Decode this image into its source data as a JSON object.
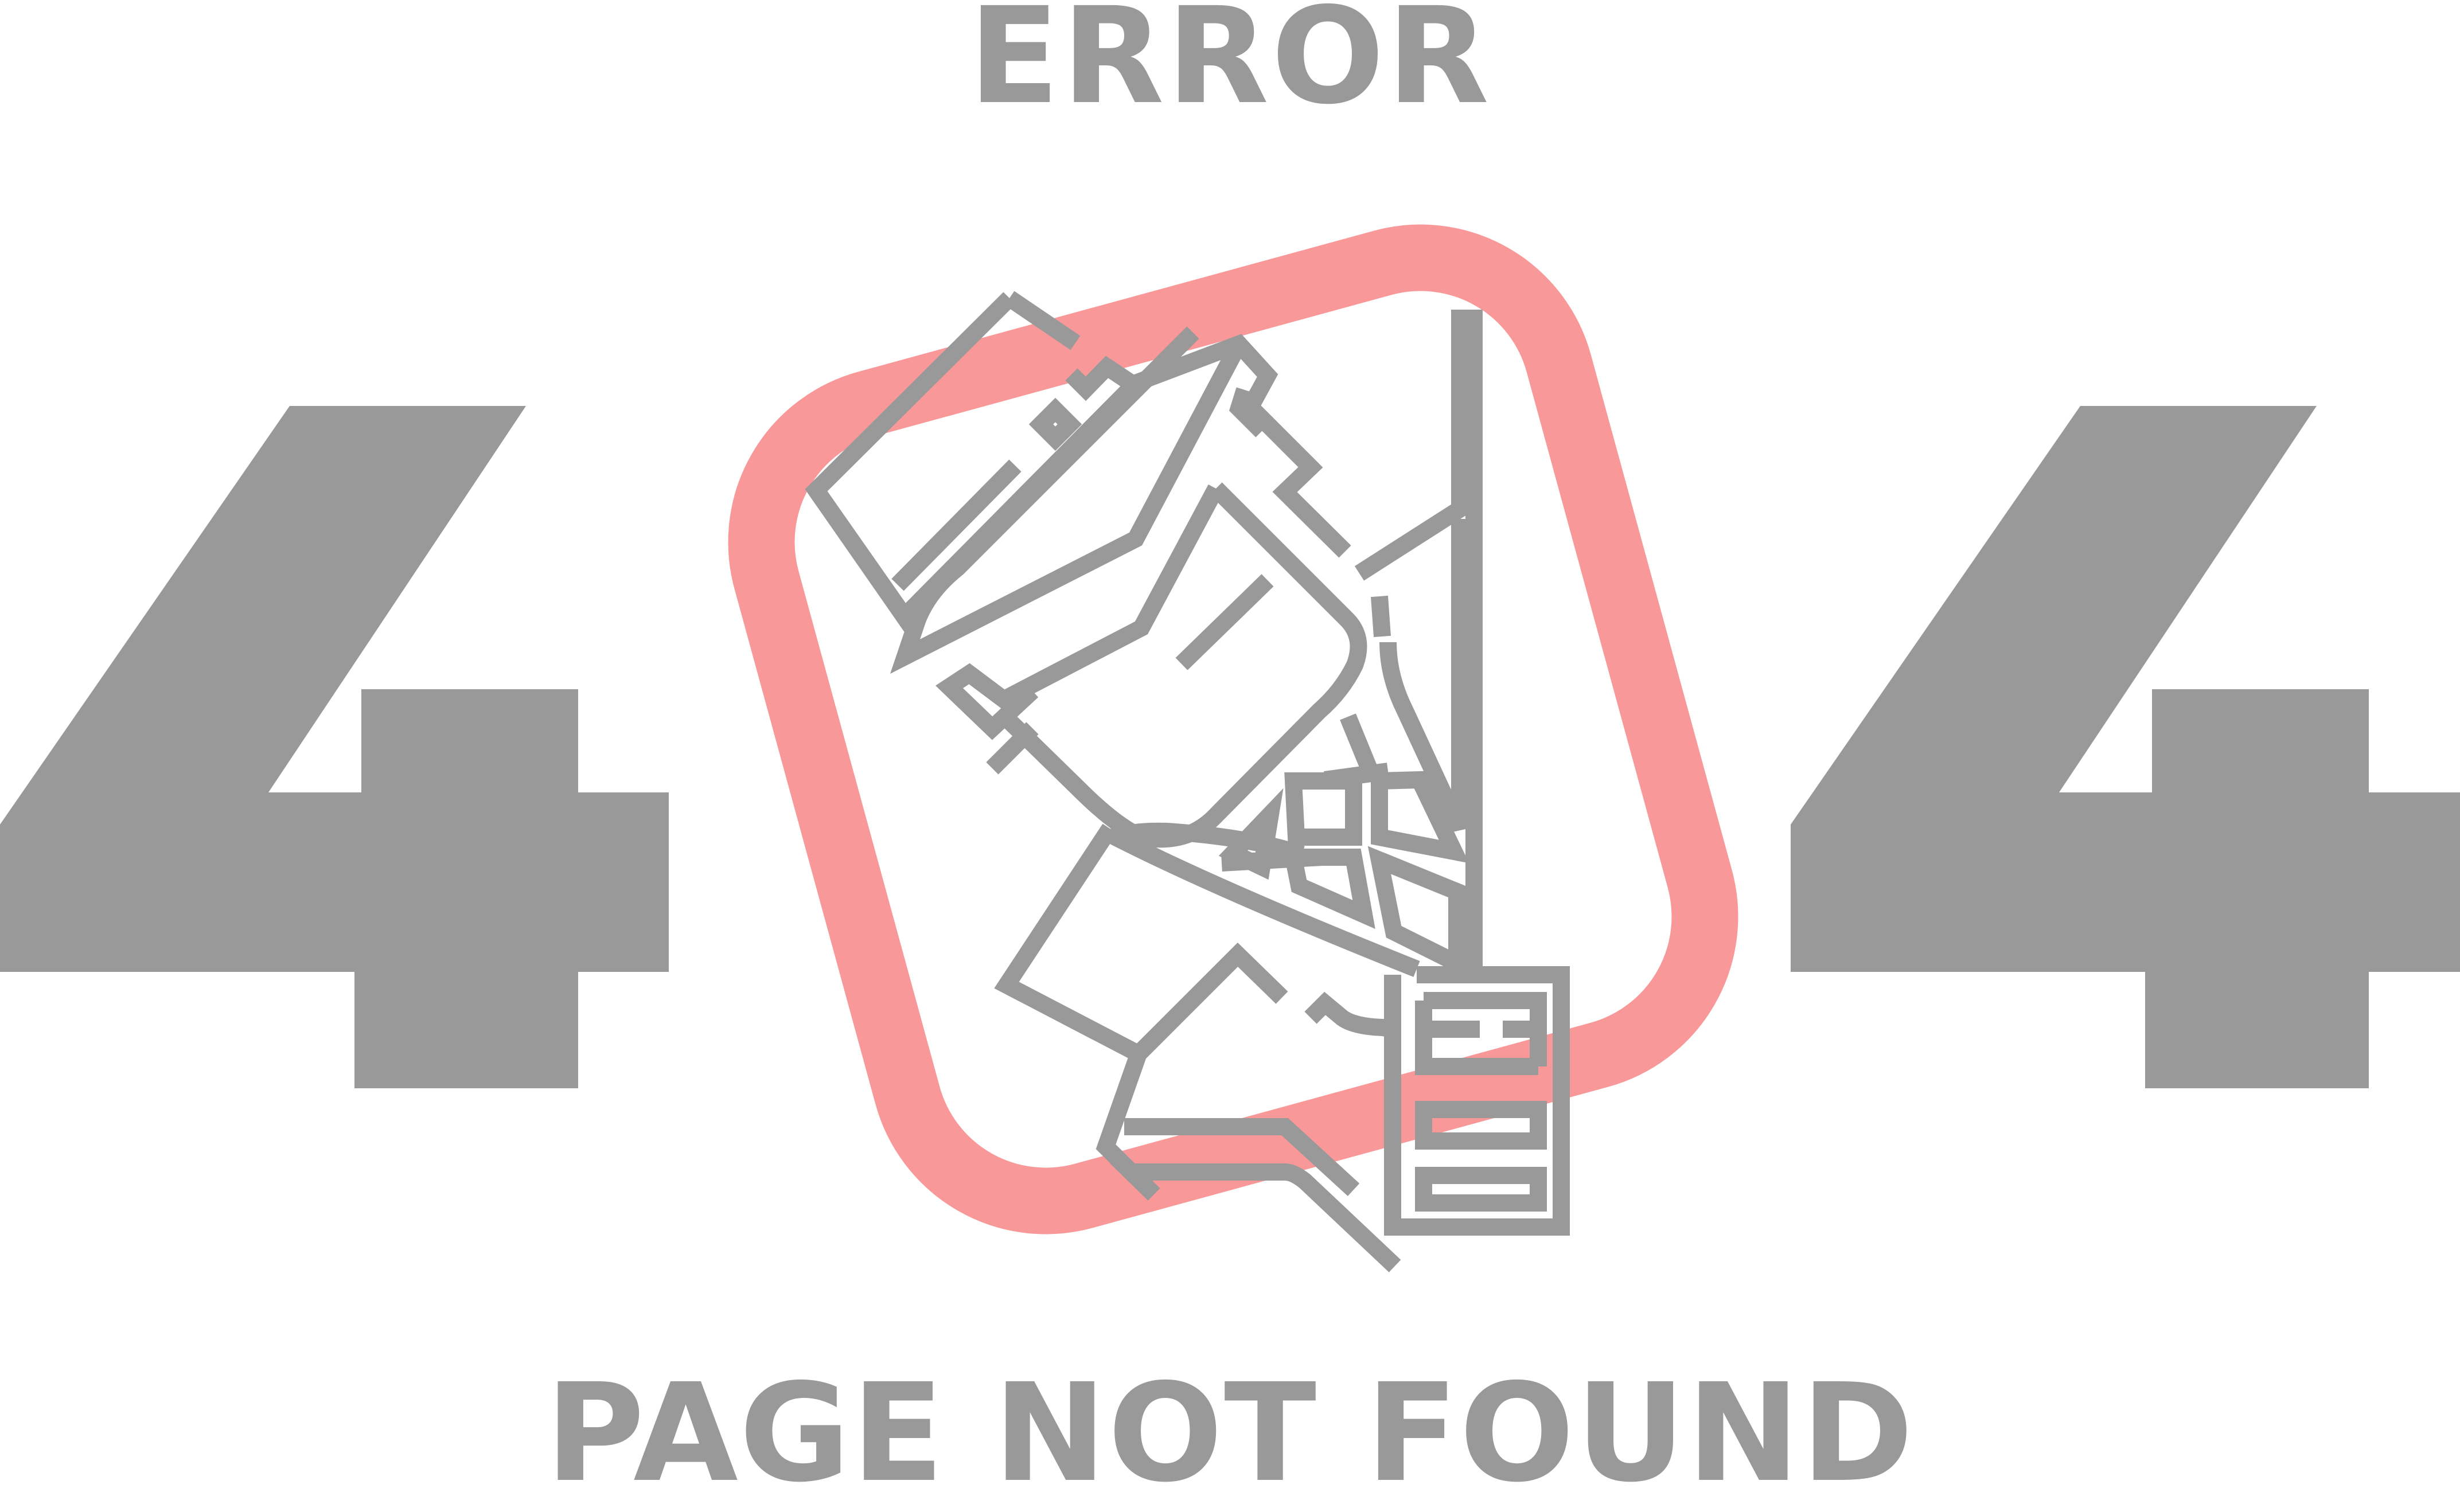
{
  "top_title": "ERROR",
  "bottom_title": "PAGE NOT FOUND",
  "code": {
    "left_digit": "4",
    "right_digit": "4"
  },
  "colors": {
    "gray": "#999999",
    "accent": "#f99898",
    "background": "#ffffff"
  },
  "illustration": {
    "icon": "broken-mail-envelope-icon"
  }
}
